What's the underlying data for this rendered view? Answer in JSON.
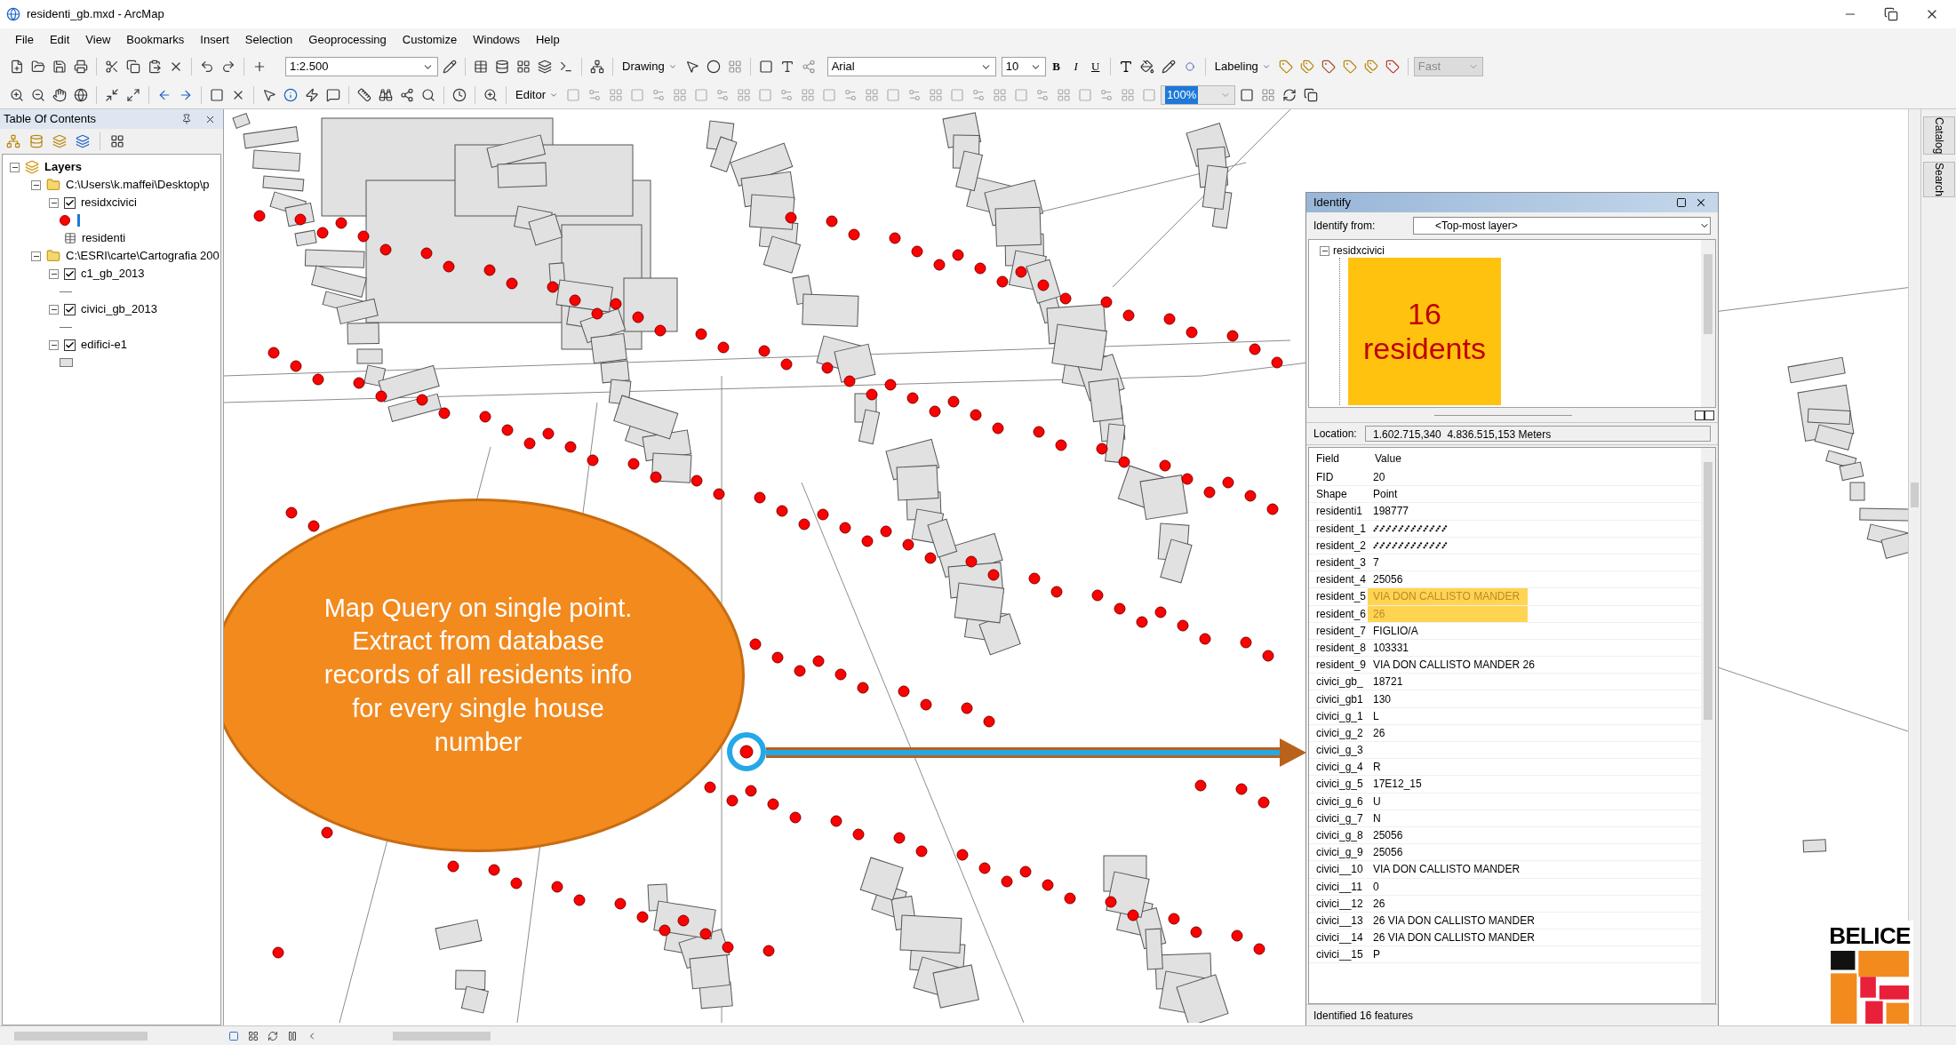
{
  "window": {
    "title": "residenti_gb.mxd - ArcMap"
  },
  "menu": [
    "File",
    "Edit",
    "View",
    "Bookmarks",
    "Insert",
    "Selection",
    "Geoprocessing",
    "Customize",
    "Windows",
    "Help"
  ],
  "toolbar": {
    "scale": "1:2.500",
    "drawing": "Drawing",
    "font": "Arial",
    "font_size": "10",
    "bold": "B",
    "italic": "I",
    "underline": "U",
    "labeling": "Labeling",
    "label_speed": "Fast",
    "editor": "Editor",
    "zoom": "100%"
  },
  "toc": {
    "title": "Table Of Contents",
    "tree": [
      {
        "label": "Layers",
        "kind": "frame",
        "expanded": true,
        "children": [
          {
            "label": "C:\\Users\\k.maffei\\Desktop\\p",
            "kind": "folder",
            "expanded": true,
            "children": [
              {
                "label": "residxcivici",
                "kind": "layer",
                "checked": true,
                "legend": {
                  "kind": "point"
                },
                "expanded": true
              },
              {
                "label": "residenti",
                "kind": "table"
              }
            ]
          },
          {
            "label": "C:\\ESRI\\carte\\Cartografia 200",
            "kind": "folder",
            "expanded": true,
            "children": [
              {
                "label": "c1_gb_2013",
                "kind": "layer",
                "checked": true,
                "legend": {
                  "kind": "line"
                },
                "expanded": true
              },
              {
                "label": "civici_gb_2013",
                "kind": "layer",
                "checked": true,
                "legend": {
                  "kind": "line"
                },
                "expanded": true
              },
              {
                "label": "edifici-e1",
                "kind": "layer",
                "checked": true,
                "legend": {
                  "kind": "polygon"
                },
                "expanded": true
              }
            ]
          }
        ]
      }
    ]
  },
  "callout": {
    "paragraphs": [
      "Map Query on single point.",
      "Extract from database records of all residents info for every single house number"
    ]
  },
  "identify": {
    "title": "Identify",
    "from_label": "Identify from:",
    "from_value": "<Top-most layer>",
    "layer": "residxcivici",
    "count_note": "16 residents",
    "location_label": "Location:",
    "location": "1.602.715,340  4.836.515,153 Meters",
    "columns": [
      "Field",
      "Value"
    ],
    "rows": [
      {
        "field": "FID",
        "value": "20"
      },
      {
        "field": "Shape",
        "value": "Point"
      },
      {
        "field": "residenti1",
        "value": "198777"
      },
      {
        "field": "resident_1",
        "redacted": true
      },
      {
        "field": "resident_2",
        "redacted": true
      },
      {
        "field": "resident_3",
        "value": "7"
      },
      {
        "field": "resident_4",
        "value": "25056"
      },
      {
        "field": "resident_5",
        "value": "VIA DON CALLISTO MANDER",
        "highlighted": true
      },
      {
        "field": "resident_6",
        "value": "26",
        "highlighted": true
      },
      {
        "field": "resident_7",
        "value": "FIGLIO/A"
      },
      {
        "field": "resident_8",
        "value": "103331"
      },
      {
        "field": "resident_9",
        "value": "VIA DON CALLISTO MANDER 26"
      },
      {
        "field": "civici_gb_",
        "value": "18721"
      },
      {
        "field": "civici_gb1",
        "value": "130"
      },
      {
        "field": "civici_g_1",
        "value": "L"
      },
      {
        "field": "civici_g_2",
        "value": "26"
      },
      {
        "field": "civici_g_3"
      },
      {
        "field": "civici_g_4",
        "value": "R"
      },
      {
        "field": "civici_g_5",
        "value": "17E12_15"
      },
      {
        "field": "civici_g_6",
        "value": "U"
      },
      {
        "field": "civici_g_7",
        "value": "N"
      },
      {
        "field": "civici_g_8",
        "value": "25056"
      },
      {
        "field": "civici_g_9",
        "value": "25056"
      },
      {
        "field": "civici__10",
        "value": "VIA DON CALLISTO MANDER"
      },
      {
        "field": "civici__11",
        "value": "0"
      },
      {
        "field": "civici__12",
        "value": "26"
      },
      {
        "field": "civici__13",
        "value": "26 VIA DON CALLISTO MANDER"
      },
      {
        "field": "civici__14",
        "value": "26 VIA DON CALLISTO MANDER"
      },
      {
        "field": "civici__15",
        "value": "P"
      }
    ],
    "status": "Identified 16 features"
  },
  "side_tabs": [
    "Catalog",
    "Search"
  ],
  "logo": {
    "text": "BELICE"
  }
}
